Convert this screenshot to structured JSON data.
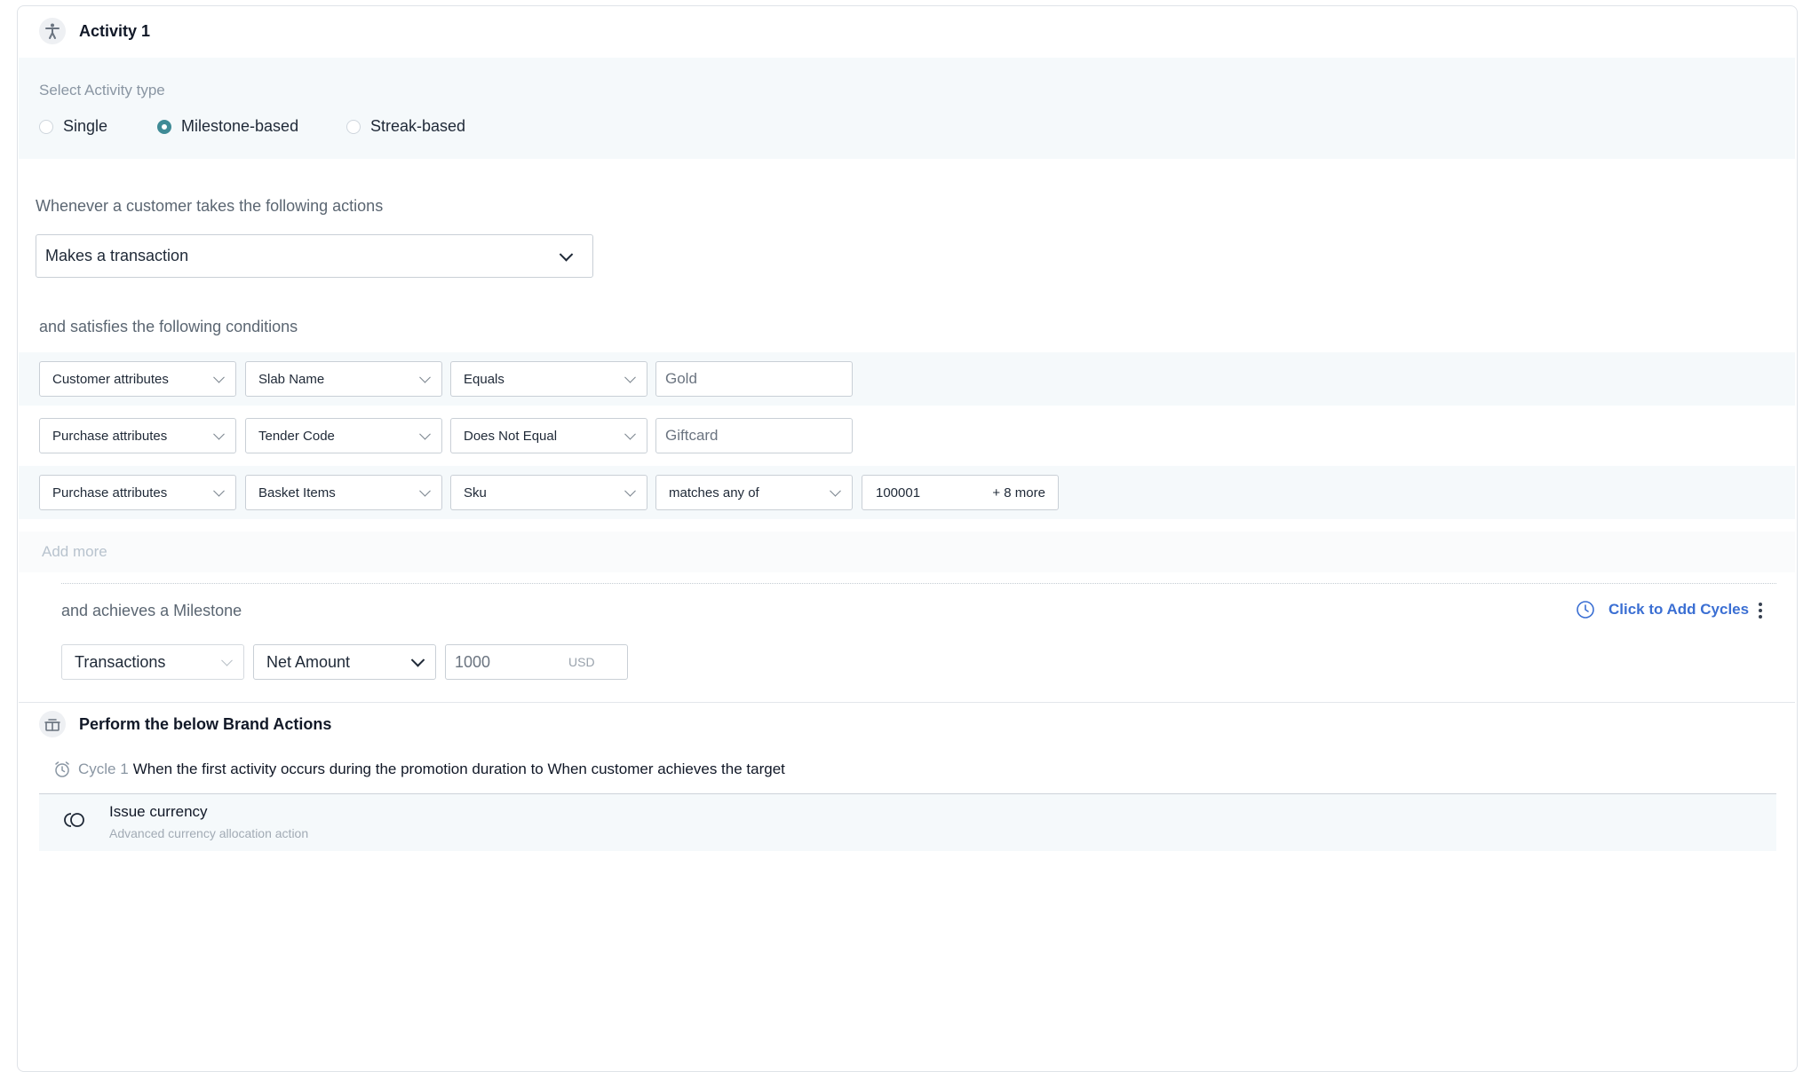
{
  "activity": {
    "title": "Activity 1",
    "type_label": "Select Activity type",
    "types": [
      "Single",
      "Milestone-based",
      "Streak-based"
    ],
    "selected_type": "Milestone-based"
  },
  "trigger": {
    "label": "Whenever a customer takes the following actions",
    "action_value": "Makes a transaction"
  },
  "conditions": {
    "label": "and satisfies the following conditions",
    "rows": [
      {
        "category": "Customer attributes",
        "attribute": "Slab Name",
        "operator": "Equals",
        "value": "Gold"
      },
      {
        "category": "Purchase attributes",
        "attribute": "Tender Code",
        "operator": "Does Not Equal",
        "value": "Giftcard"
      },
      {
        "category": "Purchase attributes",
        "attribute": "Basket Items",
        "operator": "Sku",
        "matcher": "matches any of",
        "value": "100001",
        "more": "+ 8 more"
      }
    ],
    "add_more": "Add more"
  },
  "milestone": {
    "label": "and achieves a Milestone",
    "cycles_link": "Click to Add Cycles",
    "metric": "Transactions",
    "measure": "Net Amount",
    "target": "1000",
    "unit": "USD"
  },
  "brand_actions": {
    "title": "Perform the below Brand Actions",
    "cycle_label": "Cycle 1",
    "cycle_desc": "When the first activity occurs during the promotion duration to When customer achieves the target",
    "action_name": "Issue currency",
    "action_desc": "Advanced currency allocation action"
  },
  "colors": {
    "accent": "#3f8b96",
    "link": "#3b6fd3",
    "band": "#f5f9fb"
  }
}
